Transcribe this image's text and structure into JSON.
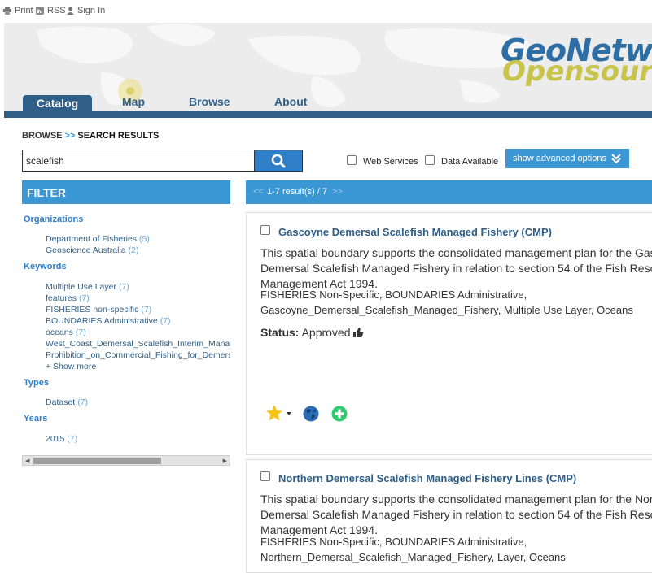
{
  "topbar": {
    "print_label": "Print",
    "rss_label": "RSS",
    "signin_label": "Sign In"
  },
  "logo": {
    "line1": "GeoNetwork",
    "line2": "Opensource"
  },
  "nav": {
    "tabs": [
      {
        "label": "Catalog"
      },
      {
        "label": "Map"
      },
      {
        "label": "Browse"
      },
      {
        "label": "About"
      }
    ]
  },
  "breadcrumb": {
    "parent": "BROWSE",
    "separator": ">>",
    "current": "SEARCH RESULTS"
  },
  "search": {
    "value": "scalefish"
  },
  "options": {
    "web_services": "Web Services",
    "data_available": "Data Available",
    "advanced": "show advanced options"
  },
  "filter": {
    "title": "FILTER",
    "groups": [
      {
        "heading": "Organizations",
        "items": [
          {
            "label": "Department of Fisheries",
            "count": "(5)"
          },
          {
            "label": "Geoscience Australia",
            "count": "(2)"
          }
        ]
      },
      {
        "heading": "Keywords",
        "items": [
          {
            "label": "Multiple Use Layer",
            "count": "(7)"
          },
          {
            "label": "features",
            "count": "(7)"
          },
          {
            "label": "FISHERIES non-specific",
            "count": "(7)"
          },
          {
            "label": "BOUNDARIES Administrative",
            "count": "(7)"
          },
          {
            "label": "oceans",
            "count": "(7)"
          },
          {
            "label": "West_Coast_Demersal_Scalefish_Interim_Managed_Fishery",
            "count": ""
          },
          {
            "label": "Prohibition_on_Commercial_Fishing_for_Demersal_Scalefish",
            "count": ""
          }
        ],
        "show_more": "+ Show more"
      },
      {
        "heading": "Types",
        "items": [
          {
            "label": "Dataset",
            "count": "(7)"
          }
        ]
      },
      {
        "heading": "Years",
        "items": [
          {
            "label": "2015",
            "count": "(7)"
          }
        ]
      }
    ]
  },
  "results": {
    "summary": "1-7 result(s) / 7",
    "prev": "<<",
    "next": ">>",
    "items": [
      {
        "title": "Gascoyne Demersal Scalefish Managed Fishery (CMP)",
        "abstract": "This spatial boundary supports the consolidated management plan for the Gascoyne Demersal Scalefish Managed Fishery in relation to section 54 of the Fish Resources Management Act 1994.",
        "keywords": "FISHERIES Non-Specific, BOUNDARIES Administrative, Gascoyne_Demersal_Scalefish_Managed_Fishery, Multiple Use Layer, Oceans",
        "status_label": "Status:",
        "status_value": "Approved"
      },
      {
        "title": "Northern Demersal Scalefish Managed Fishery Lines (CMP)",
        "abstract": "This spatial boundary supports the consolidated management plan for the Northern Demersal Scalefish Managed Fishery in relation to section 54 of the Fish Resources Management Act 1994.",
        "keywords": "FISHERIES Non-Specific, BOUNDARIES Administrative, Northern_Demersal_Scalefish_Managed_Fishery, Layer, Oceans"
      }
    ]
  },
  "colors": {
    "brand_blue": "#3b97d3",
    "nav_dark": "#2f5f87",
    "logo_blue": "#2d6fa4",
    "logo_yellow": "#c8c34a"
  }
}
